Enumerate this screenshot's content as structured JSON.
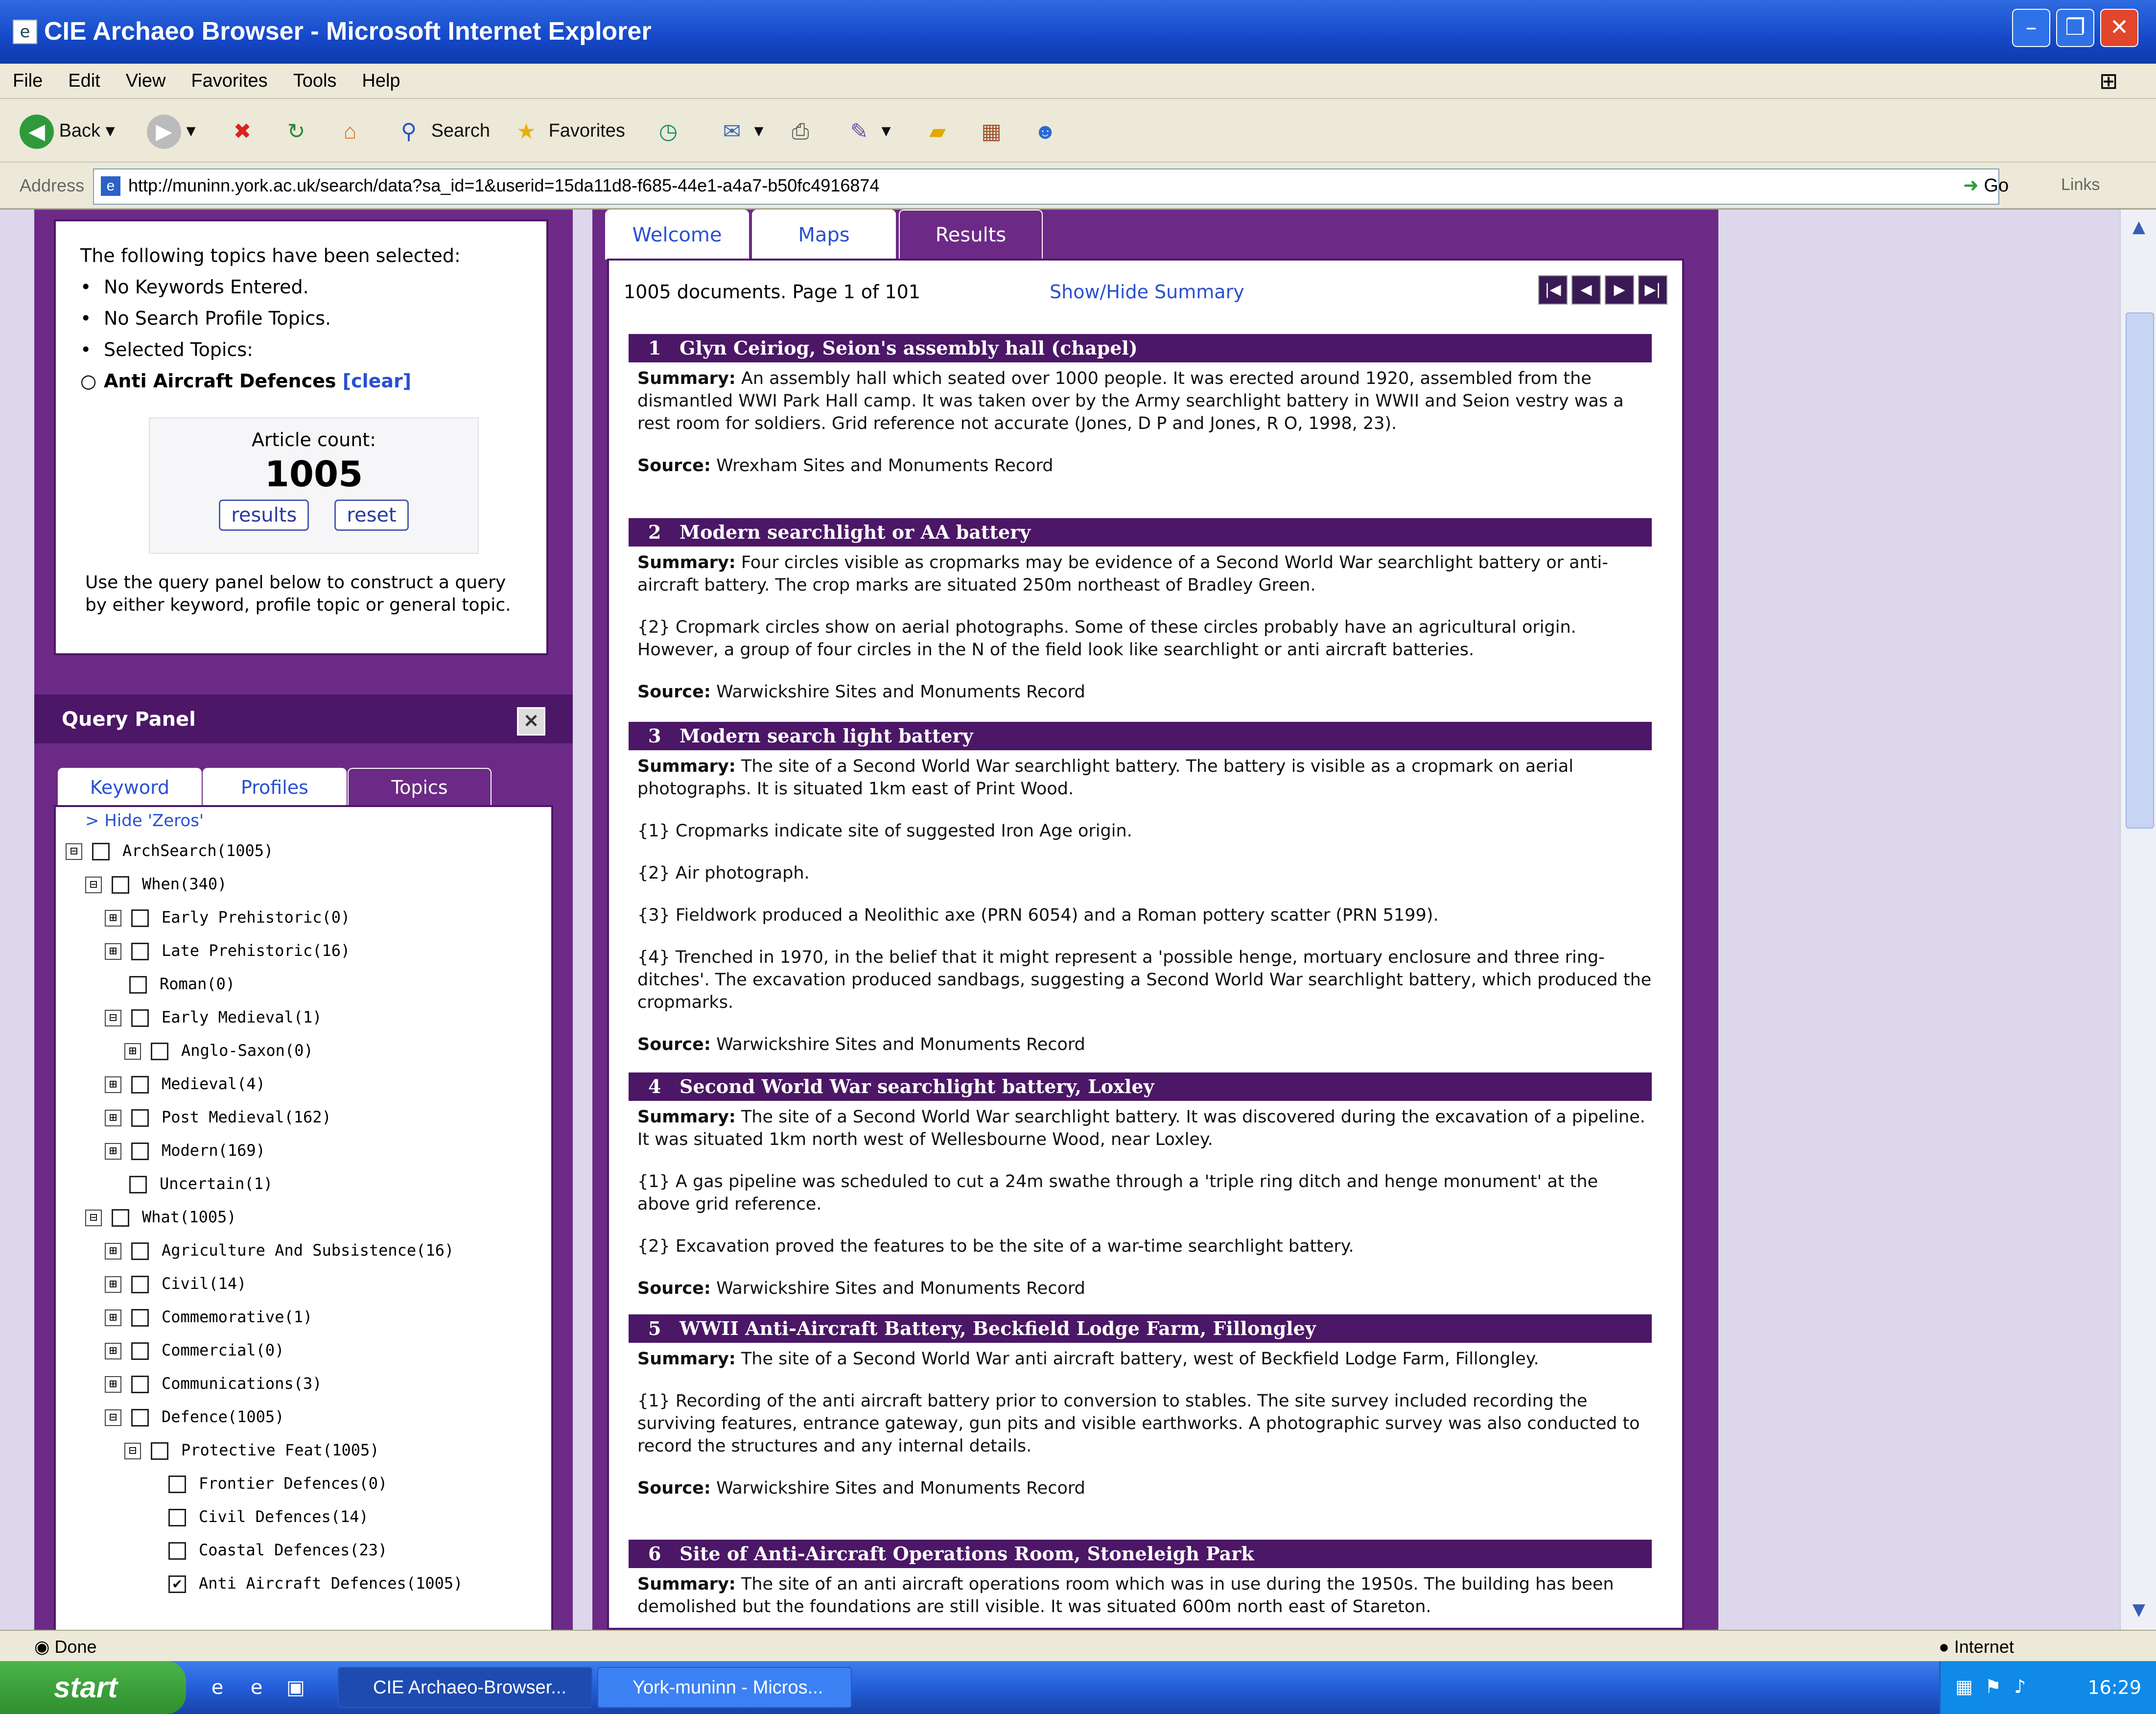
{
  "window": {
    "title": "CIE Archaeo Browser - Microsoft Internet Explorer"
  },
  "menu": [
    "File",
    "Edit",
    "View",
    "Favorites",
    "Tools",
    "Help"
  ],
  "toolbar": {
    "back": "Back",
    "search": "Search",
    "favorites": "Favorites"
  },
  "address": {
    "label": "Address",
    "url": "http://muninn.york.ac.uk/search/data?sa_id=1&userid=15da11d8-f685-44e1-a4a7-b50fc4916874",
    "go": "Go",
    "links": "Links"
  },
  "topics_panel": {
    "heading": "The following topics have been selected:",
    "no_keywords": "No Keywords Entered.",
    "no_profile": "No Search Profile Topics.",
    "selected_label": "Selected Topics:",
    "selected_topic": "Anti Aircraft Defences",
    "clear": "[clear]",
    "count_label": "Article count:",
    "count_value": "1005",
    "results_btn": "results",
    "reset_btn": "reset",
    "help": "Use the query panel below to construct a query by either keyword, profile topic or general topic."
  },
  "query_panel": {
    "title": "Query Panel",
    "collapse": "×",
    "tabs": [
      "Keyword",
      "Profiles",
      "Topics"
    ],
    "hide_zeros": "> Hide 'Zeros'",
    "tree": [
      {
        "label": "ArchSearch(1005)",
        "exp": "⊟",
        "checked": false
      },
      {
        "label": "When(340)",
        "exp": "⊟",
        "checked": false
      },
      {
        "label": "Early Prehistoric(0)",
        "exp": "⊞",
        "checked": false
      },
      {
        "label": "Late Prehistoric(16)",
        "exp": "⊞",
        "checked": false
      },
      {
        "label": "Roman(0)",
        "exp": "",
        "checked": false
      },
      {
        "label": "Early Medieval(1)",
        "exp": "⊟",
        "checked": false
      },
      {
        "label": "Anglo-Saxon(0)",
        "exp": "⊞",
        "checked": false
      },
      {
        "label": "Medieval(4)",
        "exp": "⊞",
        "checked": false
      },
      {
        "label": "Post Medieval(162)",
        "exp": "⊞",
        "checked": false
      },
      {
        "label": "Modern(169)",
        "exp": "⊞",
        "checked": false
      },
      {
        "label": "Uncertain(1)",
        "exp": "",
        "checked": false
      },
      {
        "label": "What(1005)",
        "exp": "⊟",
        "checked": false
      },
      {
        "label": "Agriculture And Subsistence(16)",
        "exp": "⊞",
        "checked": false
      },
      {
        "label": "Civil(14)",
        "exp": "⊞",
        "checked": false
      },
      {
        "label": "Commemorative(1)",
        "exp": "⊞",
        "checked": false
      },
      {
        "label": "Commercial(0)",
        "exp": "⊞",
        "checked": false
      },
      {
        "label": "Communications(3)",
        "exp": "⊞",
        "checked": false
      },
      {
        "label": "Defence(1005)",
        "exp": "⊟",
        "checked": false
      },
      {
        "label": "Protective Feat(1005)",
        "exp": "⊟",
        "checked": false
      },
      {
        "label": "Frontier Defences(0)",
        "exp": "",
        "checked": false
      },
      {
        "label": "Civil Defences(14)",
        "exp": "",
        "checked": false
      },
      {
        "label": "Coastal Defences(23)",
        "exp": "",
        "checked": false
      },
      {
        "label": "Anti Aircraft Defences(1005)",
        "exp": "",
        "checked": true
      }
    ]
  },
  "results_panel": {
    "tabs": [
      "Welcome",
      "Maps",
      "Results"
    ],
    "count": "1005 documents. Page 1 of 101",
    "show_hide": "Show/Hide Summary",
    "pager": [
      "|◀",
      "◀",
      "▶",
      "▶|"
    ],
    "summary_label": "Summary:",
    "source_label": "Source:",
    "results": [
      {
        "num": "1",
        "title": "Glyn Ceiriog, Seion's assembly hall (chapel)",
        "summary": "An assembly hall which seated over 1000 people. It was erected around 1920, assembled from the dismantled WWI Park Hall camp. It was taken over by the Army searchlight battery in WWII and Seion vestry was a rest room for soldiers. Grid reference not accurate (Jones, D P and Jones, R O, 1998, 23).",
        "notes": [],
        "source": "Wrexham Sites and Monuments Record"
      },
      {
        "num": "2",
        "title": "Modern searchlight or AA battery",
        "summary": "Four circles visible as cropmarks may be evidence of a Second World War searchlight battery or anti-aircraft battery. The crop marks are situated 250m northeast of Bradley Green.",
        "notes": [
          "{2} Cropmark circles show on aerial photographs. Some of these circles probably have an agricultural origin. However, a group of four circles in the N of the field look like searchlight or anti aircraft batteries."
        ],
        "source": "Warwickshire Sites and Monuments Record"
      },
      {
        "num": "3",
        "title": "Modern search light battery",
        "summary": "The site of a Second World War searchlight battery. The battery is visible as a cropmark on aerial photographs. It is situated 1km east of Print Wood.",
        "notes": [
          "{1} Cropmarks indicate site of suggested Iron Age origin.",
          "{2} Air photograph.",
          "{3} Fieldwork produced a Neolithic axe (PRN 6054) and a Roman pottery scatter (PRN 5199).",
          "{4} Trenched in 1970, in the belief that it might represent a 'possible henge, mortuary enclosure and three ring-ditches'. The excavation produced sandbags, suggesting a Second World War searchlight battery, which produced the cropmarks."
        ],
        "source": "Warwickshire Sites and Monuments Record"
      },
      {
        "num": "4",
        "title": "Second World War searchlight battery, Loxley",
        "summary": "The site of a Second World War searchlight battery. It was discovered during the excavation of a pipeline. It was situated 1km north west of Wellesbourne Wood, near Loxley.",
        "notes": [
          "{1} A gas pipeline was scheduled to cut a 24m swathe through a 'triple ring ditch and henge monument' at the above grid reference.",
          "{2} Excavation proved the features to be the site of a war-time searchlight battery."
        ],
        "source": "Warwickshire Sites and Monuments Record"
      },
      {
        "num": "5",
        "title": "WWII Anti-Aircraft Battery, Beckfield Lodge Farm, Fillongley",
        "summary": "The site of a Second World War anti aircraft battery, west of Beckfield Lodge Farm, Fillongley.",
        "notes": [
          "{1} Recording of the anti aircraft battery prior to conversion to stables. The site survey included recording the surviving features, entrance gateway, gun pits and visible earthworks. A photographic survey was also conducted to record the structures and any internal details."
        ],
        "source": "Warwickshire Sites and Monuments Record"
      },
      {
        "num": "6",
        "title": "Site of Anti-Aircraft Operations Room, Stoneleigh Park",
        "summary": "The site of an anti aircraft operations room which was in use during the 1950s. The building has been demolished but the foundations are still visible. It was situated 600m north east of Stareton.",
        "notes": [],
        "source": ""
      }
    ]
  },
  "status": {
    "left": "Done",
    "zone": "Internet"
  },
  "taskbar": {
    "start": "start",
    "tasks": [
      "CIE Archaeo-Browser...",
      "York-muninn - Micros..."
    ],
    "time": "16:29"
  }
}
